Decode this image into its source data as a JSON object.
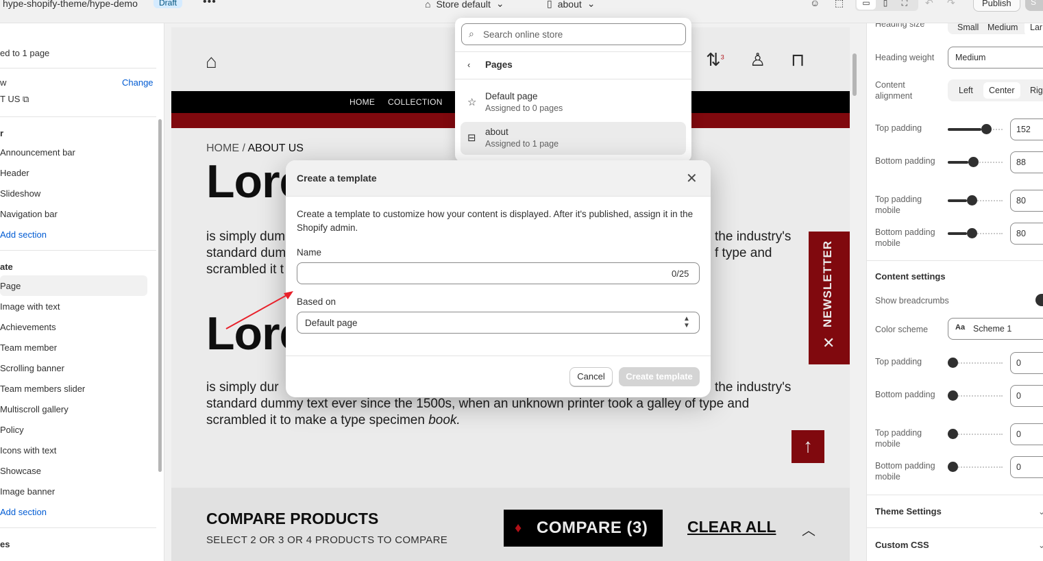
{
  "topbar": {
    "path": "hype-shopify-theme/hype-demo",
    "draft": "Draft",
    "more": "•••",
    "store_selector": "Store default",
    "page_selector": "about",
    "publish": "Publish",
    "save": "S"
  },
  "left": {
    "assigned": "ed to 1 page",
    "preview_label": "w",
    "change": "Change",
    "preview_page": "T US",
    "header_group": "r",
    "header_sections": [
      "Announcement bar",
      "Header",
      "Slideshow",
      "Navigation bar"
    ],
    "add_section_1": "Add section",
    "template_group": "ate",
    "template_sections": [
      "Page",
      "Image with text",
      "Achievements",
      "Team member",
      "Scrolling banner",
      "Team members slider",
      "Multiscroll gallery",
      "Policy",
      "Icons with text",
      "Showcase",
      "Image banner"
    ],
    "add_section_2": "Add section",
    "footer_group": "es"
  },
  "preview": {
    "nav_home": "HOME",
    "nav_collection": "COLLECTION",
    "compare_badge": "3",
    "crumb_home": "HOME",
    "crumb_sep": " / ",
    "crumb_page": "ABOUT US",
    "heading": "Lorem",
    "para_1_left": "is simply dum",
    "para_1_right_1": "the industry's",
    "para_1_line2_left": "standard dum",
    "para_1_line2_right": "f type and",
    "para_1_line3_left": "scrambled it t",
    "para_2_left": "is simply dur",
    "para_2_right": "the industry's",
    "para_2_line2": "standard dummy text ever since the 1500s, when an unknown printer took a galley of type and",
    "para_2_line3_pre": "scrambled it to make a type specimen ",
    "para_2_line3_em": "book.",
    "newsletter": "NEWSLETTER",
    "compare_title": "COMPARE PRODUCTS",
    "compare_sub": "SELECT 2 OR 3 OR 4 PRODUCTS TO COMPARE",
    "compare_btn": "COMPARE (3)",
    "clear_all": "CLEAR ALL"
  },
  "right": {
    "heading_size": "Heading size",
    "size_small": "Small",
    "size_medium": "Medium",
    "size_large": "Lar",
    "heading_weight": "Heading weight",
    "heading_weight_value": "Medium",
    "content_alignment": "Content alignment",
    "align_left": "Left",
    "align_center": "Center",
    "align_right": "Righ",
    "unit": "p",
    "sliders_1": [
      {
        "label": "Top padding",
        "value": "152",
        "level": 0.75
      },
      {
        "label": "Bottom padding",
        "value": "88",
        "level": 0.46
      },
      {
        "label": "Top padding mobile",
        "value": "80",
        "level": 0.43
      },
      {
        "label": "Bottom padding mobile",
        "value": "80",
        "level": 0.43
      }
    ],
    "content_settings": "Content settings",
    "show_breadcrumbs": "Show breadcrumbs",
    "color_scheme": "Color scheme",
    "color_scheme_value": "Scheme 1",
    "sliders_2": [
      {
        "label": "Top padding",
        "value": "0",
        "level": 0
      },
      {
        "label": "Bottom padding",
        "value": "0",
        "level": 0
      },
      {
        "label": "Top padding mobile",
        "value": "0",
        "level": 0
      },
      {
        "label": "Bottom padding mobile",
        "value": "0",
        "level": 0
      }
    ],
    "theme_settings": "Theme Settings",
    "custom_css": "Custom CSS"
  },
  "dropdown": {
    "search_placeholder": "Search online store",
    "pages": "Pages",
    "items": [
      {
        "title": "Default page",
        "subtitle": "Assigned to 0 pages"
      },
      {
        "title": "about",
        "subtitle": "Assigned to 1 page"
      }
    ]
  },
  "modal": {
    "title": "Create a template",
    "description": "Create a template to customize how your content is displayed. After it's published, assign it in the Shopify admin.",
    "name_label": "Name",
    "name_value": "",
    "name_count": "0/25",
    "based_on_label": "Based on",
    "based_on_value": "Default page",
    "cancel": "Cancel",
    "create": "Create template"
  },
  "colors": {
    "brand_red": "#8b0a10",
    "link_blue": "#005bd3",
    "annotation_arrow": "#e8202a"
  }
}
